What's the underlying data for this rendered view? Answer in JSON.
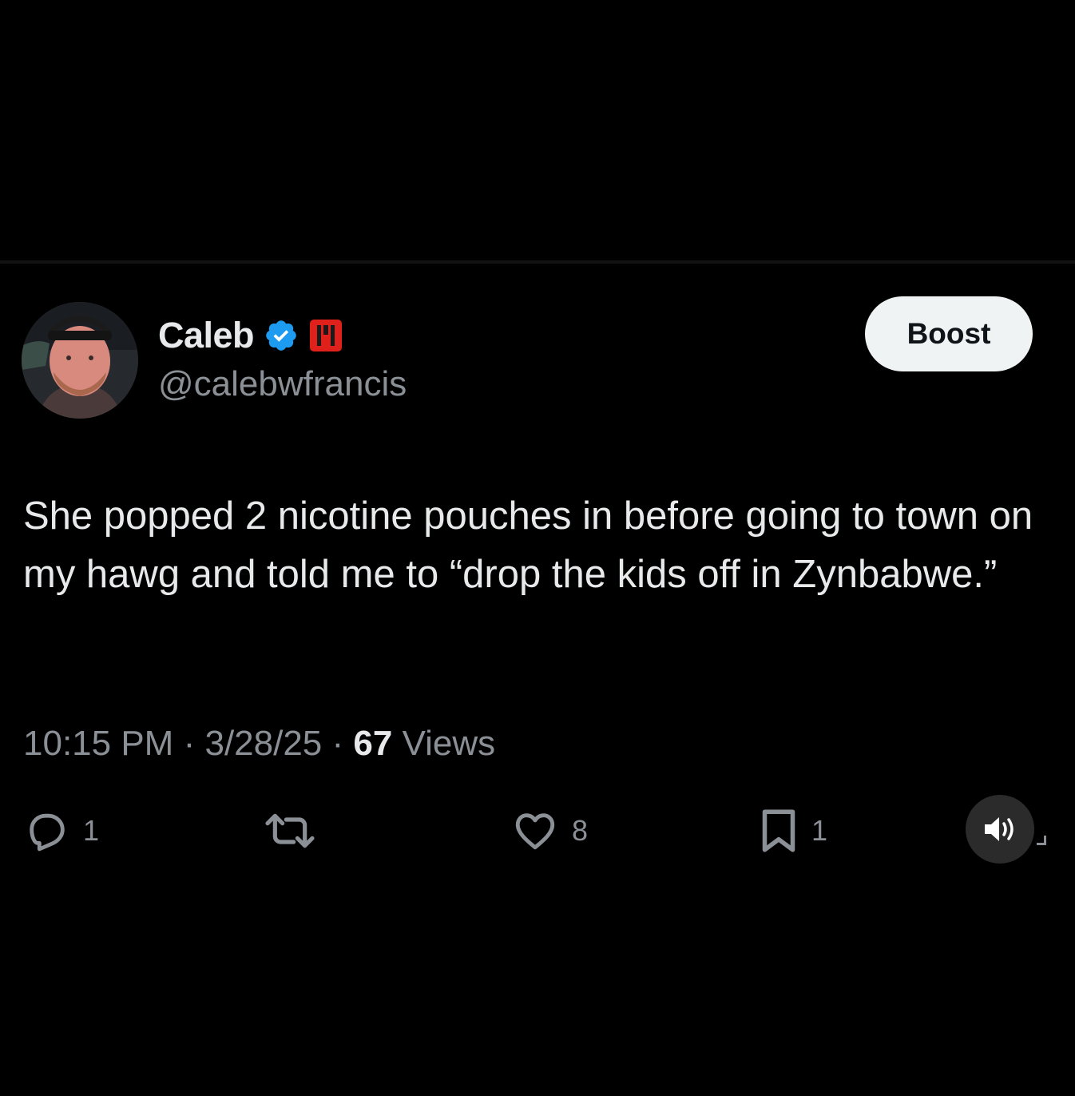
{
  "tweet": {
    "author": {
      "display_name": "Caleb",
      "handle": "@calebwfrancis",
      "avatar_icon": "profile-photo",
      "verified_icon": "verified-badge-icon",
      "affiliate_icon": "affiliate-badge-icon"
    },
    "boost_label": "Boost",
    "text": "She popped 2 nicotine pouches in before going to town on my hawg and told me to “drop the kids off in Zynbabwe.”",
    "time": "10:15 PM",
    "date": "3/28/25",
    "separator": "·",
    "views_count": "67",
    "views_label": "Views",
    "actions": {
      "replies": "1",
      "retweets": "",
      "likes": "8",
      "bookmarks": "1"
    }
  },
  "colors": {
    "background": "#000000",
    "text_primary": "#e7e9ea",
    "text_secondary": "#8b9096",
    "verified_blue": "#1d9bf0",
    "affiliate_red": "#e0211b",
    "boost_bg": "#eff3f4"
  }
}
